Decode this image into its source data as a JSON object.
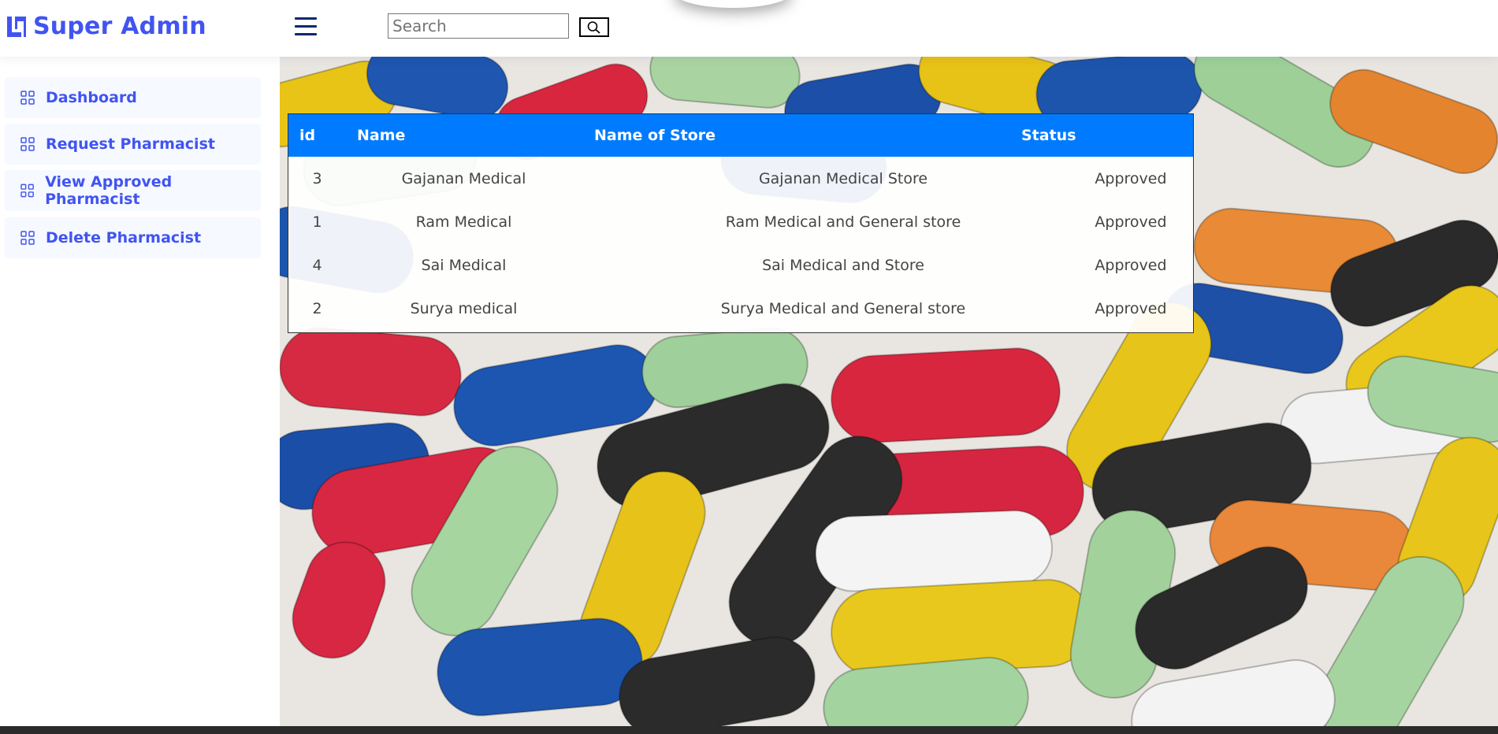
{
  "header": {
    "brand": "Super Admin",
    "search_placeholder": "Search",
    "search_value": "",
    "menu_icon": "hamburger-icon",
    "search_icon": "search-icon",
    "accent": "#4154f1"
  },
  "sidebar": {
    "items": [
      {
        "label": "Dashboard",
        "icon": "grid-icon"
      },
      {
        "label": "Request Pharmacist",
        "icon": "grid-icon"
      },
      {
        "label": "View Approved Pharmacist",
        "icon": "grid-icon"
      },
      {
        "label": "Delete Pharmacist",
        "icon": "grid-icon"
      }
    ]
  },
  "table": {
    "headers": [
      "id",
      "Name",
      "Name of Store",
      "Status"
    ],
    "header_color": "#007bff",
    "rows": [
      {
        "id": "3",
        "name": "Gajanan Medical",
        "store": "Gajanan Medical Store",
        "status": "Approved"
      },
      {
        "id": "1",
        "name": "Ram Medical",
        "store": "Ram Medical and General store",
        "status": "Approved"
      },
      {
        "id": "4",
        "name": "Sai Medical",
        "store": "Sai Medical and Store",
        "status": "Approved"
      },
      {
        "id": "2",
        "name": "Surya medical",
        "store": "Surya Medical and General store",
        "status": "Approved"
      }
    ]
  }
}
